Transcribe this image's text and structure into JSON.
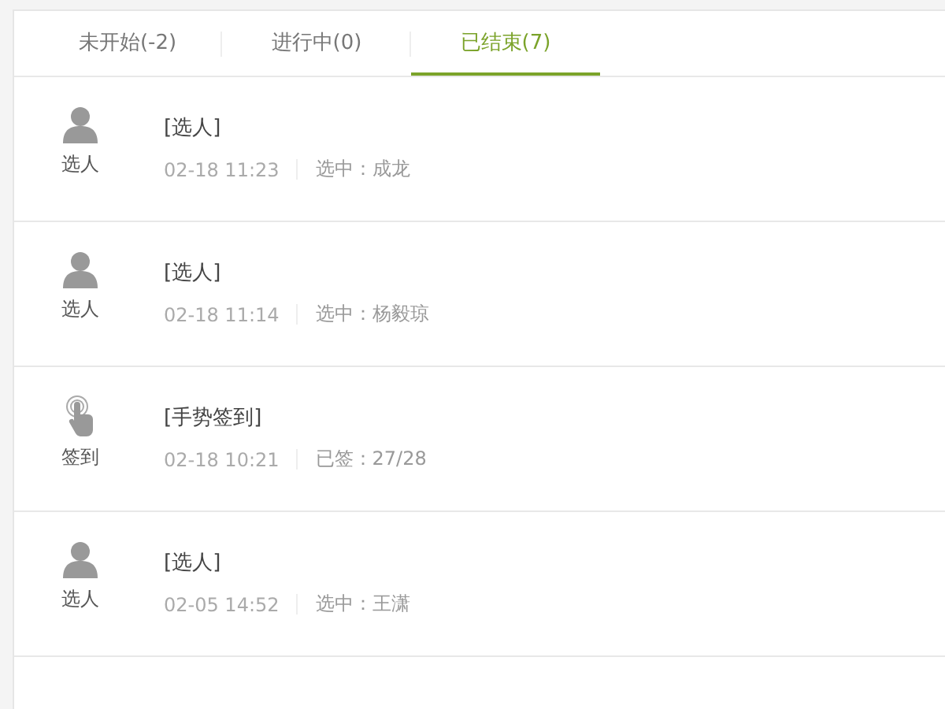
{
  "tabs": [
    {
      "label": "未开始(-2)",
      "selected": false
    },
    {
      "label": "进行中(0)",
      "selected": false
    },
    {
      "label": "已结束(7)",
      "selected": true
    }
  ],
  "activities": [
    {
      "kind": "pick",
      "type_label": "选人",
      "title": "[选人]",
      "time": "02-18 11:23",
      "result": "选中：成龙"
    },
    {
      "kind": "pick",
      "type_label": "选人",
      "title": "[选人]",
      "time": "02-18 11:14",
      "result": "选中：杨毅琼"
    },
    {
      "kind": "gesture",
      "type_label": "签到",
      "title": "[手势签到]",
      "time": "02-18 10:21",
      "result": "已签：27/28"
    },
    {
      "kind": "pick",
      "type_label": "选人",
      "title": "[选人]",
      "time": "02-05 14:52",
      "result": "选中：王潇"
    }
  ]
}
